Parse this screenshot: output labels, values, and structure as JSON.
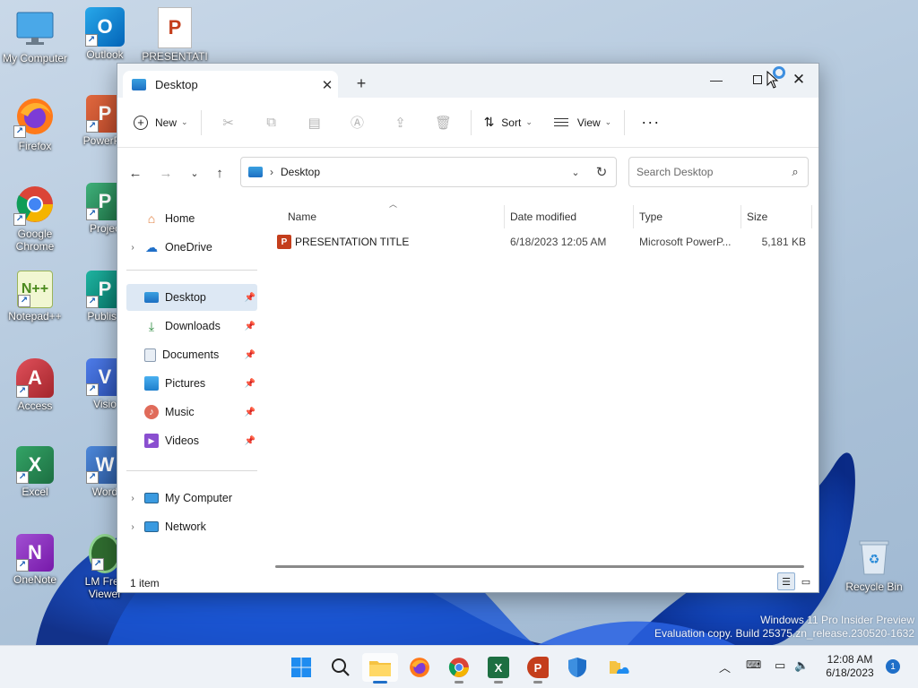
{
  "desktop": {
    "icons": [
      {
        "label": "My Computer",
        "icon": "monitor-icon"
      },
      {
        "label": "Outlook",
        "icon": "outlook-icon"
      },
      {
        "label": "PRESENTATI",
        "icon": "powerpoint-file-icon"
      },
      {
        "label": "Firefox",
        "icon": "firefox-icon"
      },
      {
        "label": "PowerPo",
        "icon": "powerpoint-icon"
      },
      {
        "label": "Google Chrome",
        "icon": "chrome-icon"
      },
      {
        "label": "Projec",
        "icon": "project-icon"
      },
      {
        "label": "Notepad++",
        "icon": "notepadpp-icon"
      },
      {
        "label": "Publish",
        "icon": "publisher-icon"
      },
      {
        "label": "Access",
        "icon": "access-icon"
      },
      {
        "label": "Visio",
        "icon": "visio-icon"
      },
      {
        "label": "Excel",
        "icon": "excel-icon"
      },
      {
        "label": "Word",
        "icon": "word-icon"
      },
      {
        "label": "OneNote",
        "icon": "onenote-icon"
      },
      {
        "label": "LM Free Viewer",
        "icon": "lm-viewer-icon"
      },
      {
        "label": "Recycle Bin",
        "icon": "recycle-bin-icon"
      }
    ],
    "watermark": {
      "line1": "Windows 11 Pro Insider Preview",
      "line2": "Evaluation copy. Build 25375.zn_release.230520-1632"
    }
  },
  "explorer": {
    "tab_title": "Desktop",
    "toolbar": {
      "new_label": "New",
      "sort_label": "Sort",
      "view_label": "View",
      "more_label": "···"
    },
    "address": {
      "path": "Desktop",
      "separator": "›"
    },
    "search": {
      "placeholder": "Search Desktop"
    },
    "nav": {
      "home": "Home",
      "onedrive": "OneDrive",
      "desktop": "Desktop",
      "downloads": "Downloads",
      "documents": "Documents",
      "pictures": "Pictures",
      "music": "Music",
      "videos": "Videos",
      "my_computer": "My Computer",
      "network": "Network"
    },
    "columns": {
      "name": "Name",
      "date": "Date modified",
      "type": "Type",
      "size": "Size"
    },
    "files": [
      {
        "name": "PRESENTATION TITLE",
        "date": "6/18/2023 12:05 AM",
        "type": "Microsoft PowerP...",
        "size": "5,181 KB"
      }
    ],
    "status": "1 item"
  },
  "taskbar": {
    "apps": [
      "start-icon",
      "search-icon",
      "file-explorer-icon",
      "firefox-icon",
      "chrome-icon",
      "excel-icon",
      "powerpoint-icon",
      "defender-icon",
      "onedrive-folder-icon"
    ],
    "time": "12:08 AM",
    "date": "6/18/2023",
    "notifications": "1"
  },
  "colors": {
    "accent": "#1f6fc8",
    "powerpoint": "#c43e1c",
    "excel": "#1d6f42",
    "word": "#2b579a"
  }
}
